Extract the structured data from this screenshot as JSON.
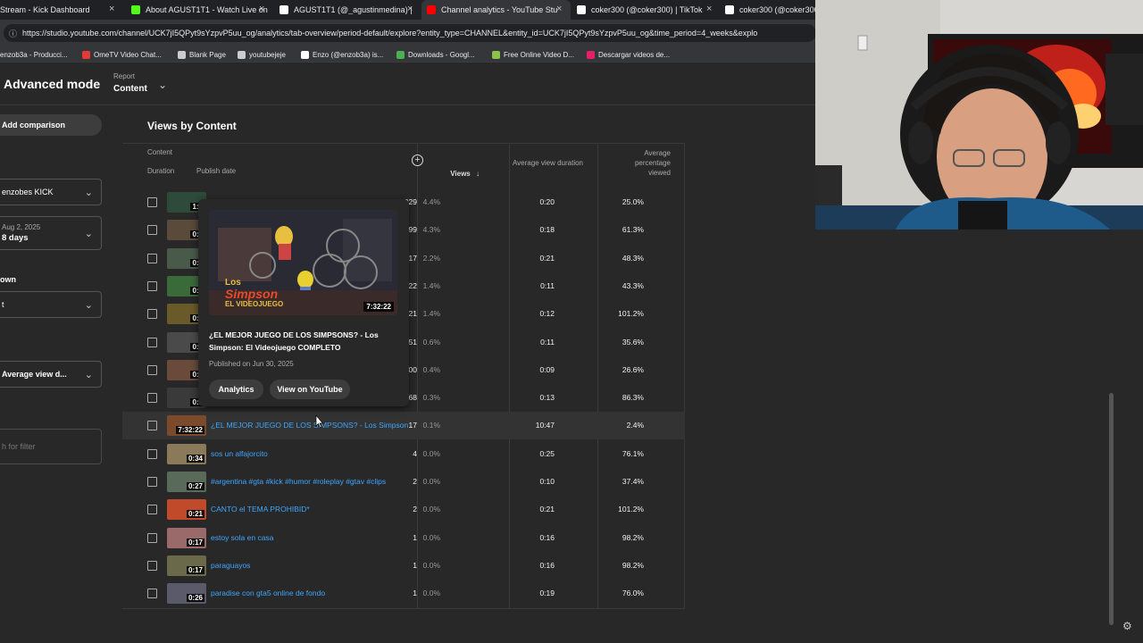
{
  "browser": {
    "tabs": [
      {
        "label": "Stream - Kick Dashboard",
        "color": "#53fc18"
      },
      {
        "label": "About AGUST1T1 - Watch Live on",
        "color": "#53fc18"
      },
      {
        "label": "AGUST1T1 (@_agustinmedina) |",
        "color": "#ffffff"
      },
      {
        "label": "Channel analytics - YouTube Stu",
        "color": "#ff0000"
      },
      {
        "label": "coker300 (@coker300) | TikTok",
        "color": "#ffffff"
      },
      {
        "label": "coker300 (@coker300) | T",
        "color": "#ffffff"
      }
    ],
    "url": "https://studio.youtube.com/channel/UCK7jI5QPyt9sYzpvP5uu_og/analytics/tab-overview/period-default/explore?entity_type=CHANNEL&entity_id=UCK7jI5QPyt9sYzpvP5uu_og&time_period=4_weeks&explo",
    "bookmarks": [
      {
        "label": "enzob3a - Producci...",
        "color": "#ff4444"
      },
      {
        "label": "OmeTV Video Chat...",
        "color": "#e53935"
      },
      {
        "label": "Blank Page",
        "color": "#cccccc"
      },
      {
        "label": "youtubejeje",
        "color": "#cccccc"
      },
      {
        "label": "Enzo (@enzob3a) is...",
        "color": "#ffffff"
      },
      {
        "label": "Downloads - Googl...",
        "color": "#4caf50"
      },
      {
        "label": "Free Online Video D...",
        "color": "#8bc34a"
      },
      {
        "label": "Descargar videos de...",
        "color": "#e91e63"
      }
    ]
  },
  "header": {
    "mode": "Advanced mode",
    "report_label": "Report",
    "report_value": "Content"
  },
  "sidebar": {
    "add_comparison": "Add comparison",
    "channel_select": "enzobes KICK",
    "date_line1": "Aug 2, 2025",
    "date_line2": "8 days",
    "breakdown_label": "own",
    "breakdown_value": "t",
    "metric_select": "Average view d...",
    "filter_placeholder": "h for filter"
  },
  "main": {
    "title": "Views by Content",
    "col_content": "Content",
    "col_duration": "Duration",
    "col_publish": "Publish date",
    "col_views": "Views",
    "col_avd": "Average view duration",
    "col_avp": "Average percentage viewed"
  },
  "rows": [
    {
      "dur": "1:3",
      "title": "",
      "views": "1,029",
      "pct": "4.4%",
      "avd": "0:20",
      "avp": "25.0%",
      "thumb": "#2d4a3a"
    },
    {
      "dur": "0:2",
      "title": "",
      "views": "999",
      "pct": "4.3%",
      "avd": "0:18",
      "avp": "61.3%",
      "thumb": "#5a4a3a"
    },
    {
      "dur": "0:2",
      "title": "",
      "views": "517",
      "pct": "2.2%",
      "avd": "0:21",
      "avp": "48.3%",
      "thumb": "#4a5a4a"
    },
    {
      "dur": "0:2",
      "title": "",
      "views": "322",
      "pct": "1.4%",
      "avd": "0:11",
      "avp": "43.3%",
      "thumb": "#3a6a3a"
    },
    {
      "dur": "0:2",
      "title": "",
      "views": "321",
      "pct": "1.4%",
      "avd": "0:12",
      "avp": "101.2%",
      "thumb": "#6a5a2a"
    },
    {
      "dur": "0:2",
      "title": "",
      "views": "151",
      "pct": "0.6%",
      "avd": "0:11",
      "avp": "35.6%",
      "thumb": "#4a4a4a"
    },
    {
      "dur": "0:2",
      "title": "",
      "views": "100",
      "pct": "0.4%",
      "avd": "0:09",
      "avp": "26.6%",
      "thumb": "#6a4a3a"
    },
    {
      "dur": "0:2",
      "title": "",
      "views": "68",
      "pct": "0.3%",
      "avd": "0:13",
      "avp": "86.3%",
      "thumb": "#3a3a3a"
    },
    {
      "dur": "7:32:22",
      "title": "¿EL MEJOR JUEGO DE LOS SIMPSONS? - Los Simpson...",
      "views": "17",
      "pct": "0.1%",
      "avd": "10:47",
      "avp": "2.4%",
      "thumb": "#7a4a2a"
    },
    {
      "dur": "0:34",
      "title": "sos un alfajorcito",
      "views": "4",
      "pct": "0.0%",
      "avd": "0:25",
      "avp": "76.1%",
      "thumb": "#8a7a5a"
    },
    {
      "dur": "0:27",
      "title": "#argentina #gta #kick #humor #roleplay #gtav #clips",
      "views": "2",
      "pct": "0.0%",
      "avd": "0:10",
      "avp": "37.4%",
      "thumb": "#5a6a5a"
    },
    {
      "dur": "0:21",
      "title": "CANTO el TEMA PROHIBID*",
      "views": "2",
      "pct": "0.0%",
      "avd": "0:21",
      "avp": "101.2%",
      "thumb": "#c04a2a"
    },
    {
      "dur": "0:17",
      "title": "estoy sola en casa",
      "views": "1",
      "pct": "0.0%",
      "avd": "0:16",
      "avp": "98.2%",
      "thumb": "#9a6a6a"
    },
    {
      "dur": "0:17",
      "title": "paraguayos",
      "views": "1",
      "pct": "0.0%",
      "avd": "0:16",
      "avp": "98.2%",
      "thumb": "#6a6a4a"
    },
    {
      "dur": "0:26",
      "title": "paradise con gta5 online de fondo",
      "views": "1",
      "pct": "0.0%",
      "avd": "0:19",
      "avp": "76.0%",
      "thumb": "#5a5a6a"
    }
  ],
  "popup": {
    "image_logo_line1": "Los",
    "image_logo_line2": "Simpson",
    "image_logo_line3": "EL VIDEOJUEGO",
    "duration": "7:32:22",
    "title": "¿EL MEJOR JUEGO DE LOS SIMPSONS? - Los Simpson: El Videojuego COMPLETO",
    "published": "Published on Jun 30, 2025",
    "btn_analytics": "Analytics",
    "btn_youtube": "View on YouTube"
  }
}
